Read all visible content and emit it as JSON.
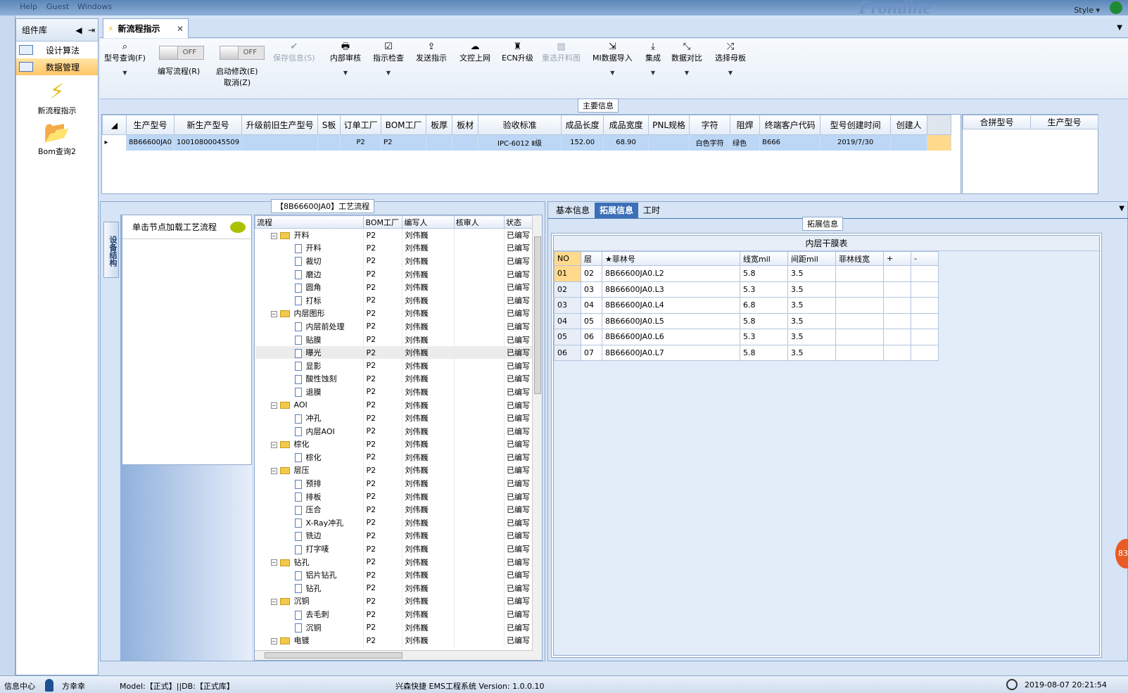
{
  "topbar": {
    "menu": [
      "Help",
      "Guest",
      "Windows"
    ],
    "logo": "Frontline",
    "style_label": "Style"
  },
  "component_panel": {
    "title": "组件库",
    "items": [
      {
        "label": "设计算法"
      },
      {
        "label": "数据管理"
      }
    ],
    "big_items": [
      {
        "label": "新流程指示"
      },
      {
        "label": "Bom查询2"
      }
    ]
  },
  "tab": {
    "title": "新流程指示"
  },
  "ribbon": {
    "buttons": [
      {
        "label": "型号查询(F)",
        "icon": "⌕"
      },
      {
        "label": "保存信息(S)",
        "icon": "✔"
      },
      {
        "label": "内部审核",
        "icon": "🖶"
      },
      {
        "label": "指示检查",
        "icon": "☑"
      },
      {
        "label": "发送指示",
        "icon": "⇪"
      },
      {
        "label": "文控上网",
        "icon": "☁"
      },
      {
        "label": "ECN升级",
        "icon": "♜"
      },
      {
        "label": "重选开料图",
        "icon": "▨"
      },
      {
        "label": "MI数据导入",
        "icon": "⇲"
      },
      {
        "label": "集成",
        "icon": "⤓"
      },
      {
        "label": "数据对比",
        "icon": "⤡"
      },
      {
        "label": "选择母板",
        "icon": "⤮"
      }
    ],
    "toggles": [
      {
        "label": "编写流程(R)",
        "state": "OFF"
      },
      {
        "label": "启动修改(E)",
        "label2": "取消(Z)",
        "state": "OFF"
      }
    ]
  },
  "main_info": {
    "caption": "主要信息",
    "columns": [
      "生产型号",
      "新生产型号",
      "升级前旧生产型号",
      "S板",
      "订单工厂",
      "BOM工厂",
      "板厚",
      "板材",
      "验收标准",
      "成品长度",
      "成品宽度",
      "PNL规格",
      "字符",
      "阻焊",
      "终端客户代码",
      "型号创建时间",
      "创建人"
    ],
    "row": [
      "8B66600JA0",
      "10010800045509",
      "",
      "",
      "P2",
      "P2",
      "",
      "",
      "IPC-6012 Ⅱ级",
      "152.00",
      "68.90",
      "",
      "白色字符",
      "绿色",
      "B666",
      "2019/7/30",
      ""
    ]
  },
  "merge_grid": {
    "columns": [
      "合拼型号",
      "生产型号"
    ]
  },
  "process": {
    "caption": "【8B66600JA0】工艺流程",
    "vtab": "设备结构",
    "node_hint": "单击节点加载工艺流程",
    "columns": [
      "流程",
      "BOM工厂",
      "编写人",
      "核审人",
      "状态"
    ],
    "rows": [
      {
        "level": 0,
        "name": "开料",
        "bom": "P2",
        "writer": "刘伟巍",
        "reviewer": "",
        "status": "已编写"
      },
      {
        "level": 1,
        "name": "开料",
        "bom": "P2",
        "writer": "刘伟巍",
        "reviewer": "",
        "status": "已编写"
      },
      {
        "level": 1,
        "name": "裁切",
        "bom": "P2",
        "writer": "刘伟巍",
        "reviewer": "",
        "status": "已编写"
      },
      {
        "level": 1,
        "name": "磨边",
        "bom": "P2",
        "writer": "刘伟巍",
        "reviewer": "",
        "status": "已编写"
      },
      {
        "level": 1,
        "name": "圆角",
        "bom": "P2",
        "writer": "刘伟巍",
        "reviewer": "",
        "status": "已编写"
      },
      {
        "level": 1,
        "name": "打标",
        "bom": "P2",
        "writer": "刘伟巍",
        "reviewer": "",
        "status": "已编写"
      },
      {
        "level": 0,
        "name": "内层图形",
        "bom": "P2",
        "writer": "刘伟巍",
        "reviewer": "",
        "status": "已编写"
      },
      {
        "level": 1,
        "name": "内层前处理",
        "bom": "P2",
        "writer": "刘伟巍",
        "reviewer": "",
        "status": "已编写"
      },
      {
        "level": 1,
        "name": "贴膜",
        "bom": "P2",
        "writer": "刘伟巍",
        "reviewer": "",
        "status": "已编写"
      },
      {
        "level": 1,
        "name": "曝光",
        "bom": "P2",
        "writer": "刘伟巍",
        "reviewer": "",
        "status": "已编写"
      },
      {
        "level": 1,
        "name": "显影",
        "bom": "P2",
        "writer": "刘伟巍",
        "reviewer": "",
        "status": "已编写"
      },
      {
        "level": 1,
        "name": "酸性蚀刻",
        "bom": "P2",
        "writer": "刘伟巍",
        "reviewer": "",
        "status": "已编写"
      },
      {
        "level": 1,
        "name": "退膜",
        "bom": "P2",
        "writer": "刘伟巍",
        "reviewer": "",
        "status": "已编写"
      },
      {
        "level": 0,
        "name": "AOI",
        "bom": "P2",
        "writer": "刘伟巍",
        "reviewer": "",
        "status": "已编写"
      },
      {
        "level": 1,
        "name": "冲孔",
        "bom": "P2",
        "writer": "刘伟巍",
        "reviewer": "",
        "status": "已编写"
      },
      {
        "level": 1,
        "name": "内层AOI",
        "bom": "P2",
        "writer": "刘伟巍",
        "reviewer": "",
        "status": "已编写"
      },
      {
        "level": 0,
        "name": "棕化",
        "bom": "P2",
        "writer": "刘伟巍",
        "reviewer": "",
        "status": "已编写"
      },
      {
        "level": 1,
        "name": "棕化",
        "bom": "P2",
        "writer": "刘伟巍",
        "reviewer": "",
        "status": "已编写"
      },
      {
        "level": 0,
        "name": "层压",
        "bom": "P2",
        "writer": "刘伟巍",
        "reviewer": "",
        "status": "已编写"
      },
      {
        "level": 1,
        "name": "预排",
        "bom": "P2",
        "writer": "刘伟巍",
        "reviewer": "",
        "status": "已编写"
      },
      {
        "level": 1,
        "name": "排板",
        "bom": "P2",
        "writer": "刘伟巍",
        "reviewer": "",
        "status": "已编写"
      },
      {
        "level": 1,
        "name": "压合",
        "bom": "P2",
        "writer": "刘伟巍",
        "reviewer": "",
        "status": "已编写"
      },
      {
        "level": 1,
        "name": "X-Ray冲孔",
        "bom": "P2",
        "writer": "刘伟巍",
        "reviewer": "",
        "status": "已编写"
      },
      {
        "level": 1,
        "name": "铣边",
        "bom": "P2",
        "writer": "刘伟巍",
        "reviewer": "",
        "status": "已编写"
      },
      {
        "level": 1,
        "name": "打字唛",
        "bom": "P2",
        "writer": "刘伟巍",
        "reviewer": "",
        "status": "已编写"
      },
      {
        "level": 0,
        "name": "钻孔",
        "bom": "P2",
        "writer": "刘伟巍",
        "reviewer": "",
        "status": "已编写"
      },
      {
        "level": 1,
        "name": "铝片钻孔",
        "bom": "P2",
        "writer": "刘伟巍",
        "reviewer": "",
        "status": "已编写"
      },
      {
        "level": 1,
        "name": "钻孔",
        "bom": "P2",
        "writer": "刘伟巍",
        "reviewer": "",
        "status": "已编写"
      },
      {
        "level": 0,
        "name": "沉铜",
        "bom": "P2",
        "writer": "刘伟巍",
        "reviewer": "",
        "status": "已编写"
      },
      {
        "level": 1,
        "name": "去毛刺",
        "bom": "P2",
        "writer": "刘伟巍",
        "reviewer": "",
        "status": "已编写"
      },
      {
        "level": 1,
        "name": "沉铜",
        "bom": "P2",
        "writer": "刘伟巍",
        "reviewer": "",
        "status": "已编写"
      },
      {
        "level": 0,
        "name": "电镀",
        "bom": "P2",
        "writer": "刘伟巍",
        "reviewer": "",
        "status": "已编写"
      }
    ]
  },
  "right_panel": {
    "tabs": [
      "基本信息",
      "拓展信息",
      "工时"
    ],
    "caption": "拓展信息",
    "table_title": "内层干膜表",
    "columns": [
      "NO",
      "层",
      "★菲林号",
      "线宽mil",
      "间距mil",
      "菲林线宽",
      "+",
      "-"
    ],
    "rows": [
      [
        "01",
        "02",
        "8B66600JA0.L2",
        "5.8",
        "3.5",
        "",
        "",
        ""
      ],
      [
        "02",
        "03",
        "8B66600JA0.L3",
        "5.3",
        "3.5",
        "",
        "",
        ""
      ],
      [
        "03",
        "04",
        "8B66600JA0.L4",
        "6.8",
        "3.5",
        "",
        "",
        ""
      ],
      [
        "04",
        "05",
        "8B66600JA0.L5",
        "5.8",
        "3.5",
        "",
        "",
        ""
      ],
      [
        "05",
        "06",
        "8B66600JA0.L6",
        "5.3",
        "3.5",
        "",
        "",
        ""
      ],
      [
        "06",
        "07",
        "8B66600JA0.L7",
        "5.8",
        "3.5",
        "",
        "",
        ""
      ]
    ]
  },
  "status": {
    "info_center": "信息中心",
    "user": "方幸幸",
    "model": "Model:【正式】||DB:【正式库】",
    "system": "兴森快捷 EMS工程系统 Version: 1.0.0.10",
    "datetime": "2019-08-07 20:21:54",
    "badge": "83"
  },
  "colors": {
    "accent": "#3d6fb7",
    "selection": "#bcd7f6",
    "highlight": "#ffc668"
  }
}
